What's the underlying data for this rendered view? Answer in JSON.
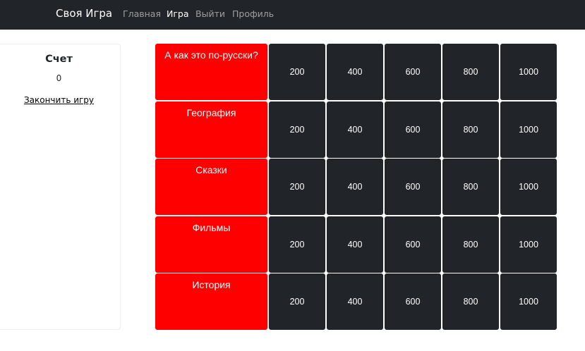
{
  "navbar": {
    "brand": "Своя Игра",
    "links": [
      {
        "label": "Главная",
        "active": false
      },
      {
        "label": "Игра",
        "active": true
      },
      {
        "label": "Выйти",
        "active": false
      },
      {
        "label": "Профиль",
        "active": false
      }
    ]
  },
  "score": {
    "title": "Счет",
    "value": "0",
    "end_game_label": "Закончить игру"
  },
  "board": {
    "categories": [
      {
        "name": "А как это по-русски?",
        "values": [
          "200",
          "400",
          "600",
          "800",
          "1000"
        ]
      },
      {
        "name": "География",
        "values": [
          "200",
          "400",
          "600",
          "800",
          "1000"
        ]
      },
      {
        "name": "Сказки",
        "values": [
          "200",
          "400",
          "600",
          "800",
          "1000"
        ]
      },
      {
        "name": "Фильмы",
        "values": [
          "200",
          "400",
          "600",
          "800",
          "1000"
        ]
      },
      {
        "name": "История",
        "values": [
          "200",
          "400",
          "600",
          "800",
          "1000"
        ]
      }
    ]
  },
  "colors": {
    "navbar_bg": "#212529",
    "category_bg": "#ff0000",
    "cell_bg": "#212529"
  }
}
